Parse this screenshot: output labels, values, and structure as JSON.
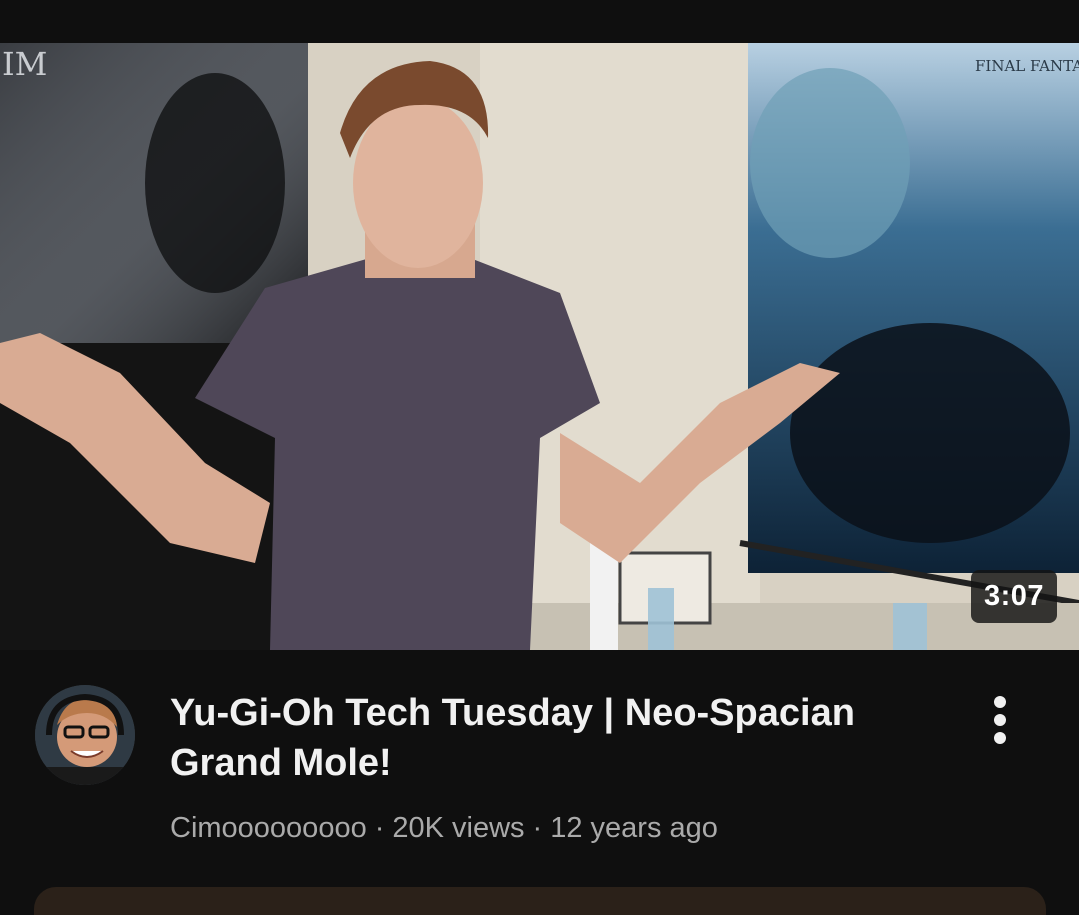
{
  "video": {
    "duration": "3:07",
    "poster_left_text": "IM",
    "poster_right_text": "FINAL FANTASY"
  },
  "details": {
    "title": "Yu-Gi-Oh Tech Tuesday | Neo-Spacian Grand Mole!",
    "channel": "Cimooooooooo",
    "separator": "·",
    "views": "20K views",
    "age": "12 years ago"
  },
  "icons": {
    "more": "more-vert-icon"
  },
  "colors": {
    "background": "#0f0f0f",
    "text_primary": "#f1f1f1",
    "text_secondary": "#aaaaaa",
    "next_card": "#2b2119"
  }
}
